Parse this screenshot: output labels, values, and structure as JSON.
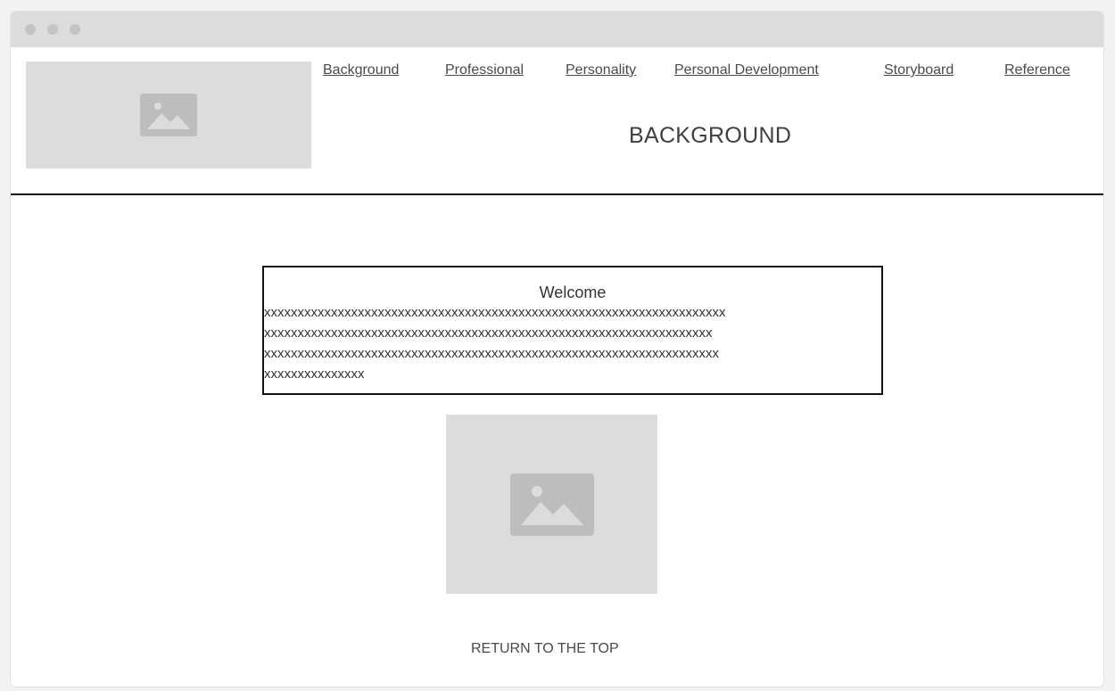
{
  "nav": {
    "items": [
      {
        "label": "Background"
      },
      {
        "label": "Professional"
      },
      {
        "label": "Personality"
      },
      {
        "label": "Personal Development"
      },
      {
        "label": "Storyboard"
      },
      {
        "label": "Reference"
      }
    ]
  },
  "header": {
    "title": "BACKGROUND"
  },
  "welcome": {
    "title": "Welcome",
    "lines": [
      "xxxxxxxxxxxxxxxxxxxxxxxxxxxxxxxxxxxxxxxxxxxxxxxxxxxxxxxxxxxxxxxxxxxxx",
      "xxxxxxxxxxxxxxxxxxxxxxxxxxxxxxxxxxxxxxxxxxxxxxxxxxxxxxxxxxxxxxxxxxx",
      "xxxxxxxxxxxxxxxxxxxxxxxxxxxxxxxxxxxxxxxxxxxxxxxxxxxxxxxxxxxxxxxxxxxx",
      "xxxxxxxxxxxxxxx"
    ]
  },
  "footer": {
    "return_label": "RETURN TO THE TOP"
  },
  "icons": {
    "logo": "image-placeholder-icon",
    "content_image": "image-placeholder-icon"
  },
  "colors": {
    "placeholder_bg": "#dcdcdc",
    "placeholder_icon": "#bdbdbd",
    "titlebar": "#dcdcdc"
  }
}
